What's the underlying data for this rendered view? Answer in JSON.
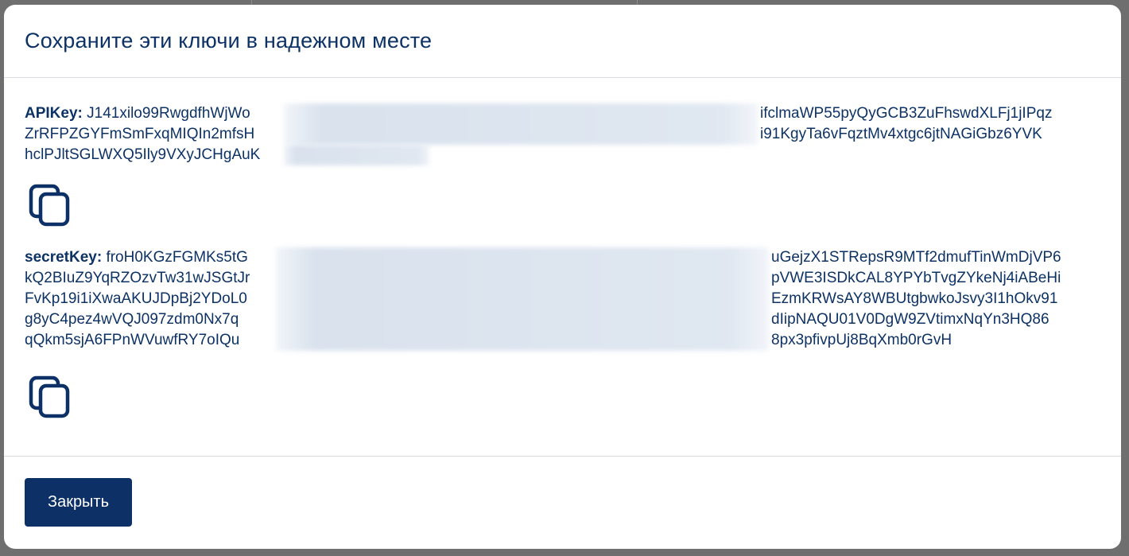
{
  "modal": {
    "title": "Сохраните эти ключи в надежном месте",
    "api_key": {
      "label": "APIKey:",
      "line1": "J141xilo99RwgdfhWjWo",
      "line1_end": "ifclmaWP55pyQyGCB3ZuFhswdXLFj1jIPqz",
      "line2": "ZrRFPZGYFmSmFxqMIQIn2mfsH",
      "line2_end": "i91KgyTa6vFqztMv4xtgc6jtNAGiGbz6YVK",
      "line3": "hclPJltSGLWXQ5Ily9VXyJCHgAuK",
      "copy_icon": "copy-icon"
    },
    "secret_key": {
      "label": "secretKey:",
      "line1": "froH0KGzFGMKs5tG",
      "line1_end": "uGejzX1STRepsR9MTf2dmufTinWmDjVP6",
      "line2": "kQ2BIuZ9YqRZOzvTw31wJSGtJr",
      "line2_end": "pVWE3ISDkCAL8YPYbTvgZYkeNj4iABeHi",
      "line3": "FvKp19i1iXwaAKUJDpBj2YDoL0",
      "line3_end": "EzmKRWsAY8WBUtgbwkoJsvy3I1hOkv91",
      "line4": "g8yC4pez4wVQJ097zdm0Nx7q",
      "line4_end": "dIipNAQU01V0DgW9ZVtimxNqYn3HQ86",
      "line5": "qQkm5sjA6FPnWVuwfRY7oIQu",
      "line5_end": "8px3pfivpUj8BqXmb0rGvH",
      "copy_icon": "copy-icon"
    },
    "close_label": "Закрыть"
  },
  "colors": {
    "primary": "#0d3066",
    "text": "#0d3266",
    "backdrop": "#6f6f6f"
  }
}
